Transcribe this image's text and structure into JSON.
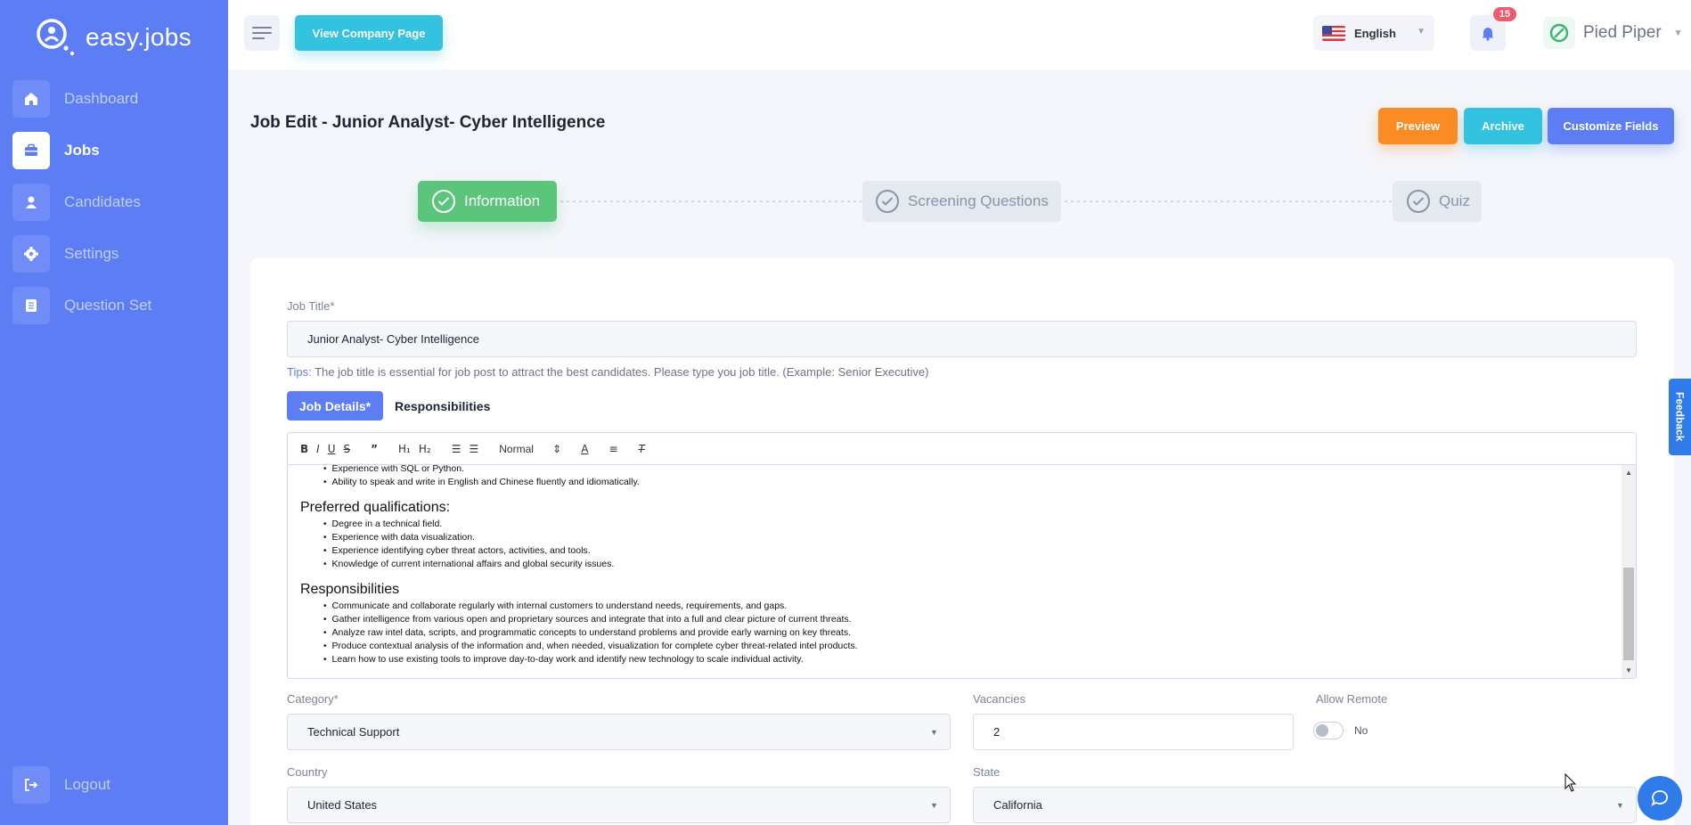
{
  "brand": {
    "name": "easy.jobs"
  },
  "sidebar": {
    "items": [
      {
        "label": "Dashboard",
        "icon": "home-icon"
      },
      {
        "label": "Jobs",
        "icon": "briefcase-icon",
        "active": true
      },
      {
        "label": "Candidates",
        "icon": "user-icon"
      },
      {
        "label": "Settings",
        "icon": "gear-icon"
      },
      {
        "label": "Question Set",
        "icon": "document-icon"
      }
    ],
    "logout": "Logout"
  },
  "topbar": {
    "view_company_label": "View Company Page",
    "language": "English",
    "notification_count": "15",
    "company_name": "Pied Piper"
  },
  "page": {
    "title": "Job Edit - Junior Analyst- Cyber Intelligence",
    "actions": {
      "preview": "Preview",
      "archive": "Archive",
      "customize": "Customize Fields"
    }
  },
  "stepper": {
    "steps": [
      {
        "label": "Information",
        "state": "active"
      },
      {
        "label": "Screening Questions",
        "state": "pending"
      },
      {
        "label": "Quiz",
        "state": "pending"
      }
    ]
  },
  "form": {
    "job_title_label": "Job Title*",
    "job_title_value": "Junior Analyst-  Cyber Intelligence",
    "tips_prefix": "Tips:",
    "tips_text": " The job title is essential for job post to attract the best candidates. Please type you job title. (Example: Senior Executive)",
    "tabs": {
      "details": "Job Details*",
      "responsibilities": "Responsibilities"
    },
    "editor": {
      "toolbar_heading_select": "Normal",
      "requirements_tail": [
        "Experience with SQL or Python.",
        "Ability to speak and write in English and Chinese fluently and idiomatically."
      ],
      "preferred_heading": "Preferred qualifications:",
      "preferred": [
        "Degree in a technical field.",
        "Experience with data visualization.",
        "Experience identifying cyber threat actors, activities, and tools.",
        "Knowledge of current international affairs and global security issues."
      ],
      "responsibilities_heading": "Responsibilities",
      "responsibilities": [
        "Communicate and collaborate regularly with internal customers to understand needs, requirements, and gaps.",
        "Gather intelligence from various open and proprietary sources and integrate that into a full and clear picture of current threats.",
        "Analyze raw intel data, scripts, and programmatic concepts to understand problems and provide early warning on key threats.",
        "Produce contextual analysis of the information and, when needed, visualization for complete cyber threat-related intel products.",
        "Learn how to use existing tools to improve day-to-day work and identify new technology to scale individual activity."
      ]
    },
    "category_label": "Category*",
    "category_value": "Technical Support",
    "vacancies_label": "Vacancies",
    "vacancies_value": "2",
    "remote_label": "Allow Remote",
    "remote_value": "No",
    "country_label": "Country",
    "country_value": "United States",
    "state_label": "State",
    "state_value": "California"
  },
  "widgets": {
    "feedback": "Feedback"
  },
  "colors": {
    "primary": "#5d7df5",
    "success": "#5bc57c",
    "warning": "#fb8b24",
    "info": "#33c2e0"
  }
}
